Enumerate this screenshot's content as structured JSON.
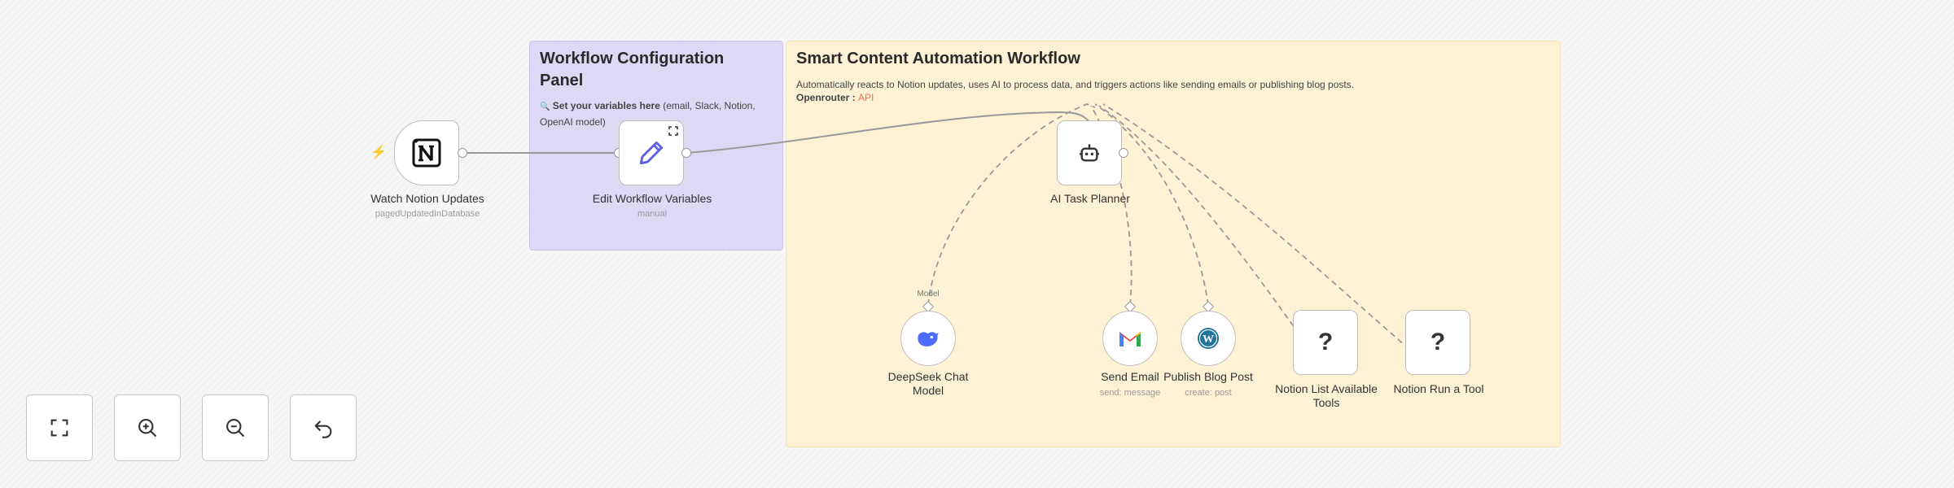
{
  "stickies": {
    "config": {
      "title": "Workflow Configuration Panel",
      "body_icon": "🔍",
      "body_bold": "Set your variables here",
      "body_rest": " (email, Slack, Notion, OpenAI model)"
    },
    "main": {
      "title": "Smart Content Automation Workflow",
      "body": "Automatically reacts to Notion updates, uses AI to process data, and triggers actions like sending emails or publishing blog posts.",
      "provider_label": "Openrouter : ",
      "provider_link": "API"
    }
  },
  "nodes": {
    "trigger": {
      "label": "Watch Notion Updates",
      "sub": "pagedUpdatedInDatabase",
      "icon": "notion-icon",
      "bolt_icon": "⚡"
    },
    "edit": {
      "label": "Edit Workflow Variables",
      "sub": "manual",
      "icon": "pencil-icon"
    },
    "agent": {
      "label": "AI Task Planner",
      "icon": "robot-icon"
    },
    "deepseek": {
      "label_line1": "DeepSeek Chat",
      "label_line2": "Model",
      "port_label": "Model",
      "icon": "deepseek-whale-icon"
    },
    "gmail": {
      "label": "Send Email",
      "sub": "send: message",
      "icon": "gmail-icon",
      "glyph": "M"
    },
    "wordpress": {
      "label": "Publish Blog Post",
      "sub": "create: post",
      "icon": "wordpress-icon",
      "glyph": "W"
    },
    "notion_list": {
      "label_line1": "Notion List Available",
      "label_line2": "Tools",
      "glyph": "?",
      "icon": "question-icon"
    },
    "notion_run": {
      "label": "Notion Run a Tool",
      "glyph": "?",
      "icon": "question-icon"
    }
  },
  "controls": {
    "fit": "fit-view-icon",
    "zoom_in": "zoom-in-icon",
    "zoom_out": "zoom-out-icon",
    "reset": "undo-icon"
  },
  "colors": {
    "accent": "#ff6d5a",
    "sticky_purple": "#dcd9f5",
    "sticky_yellow": "#fdf2d3",
    "deepseek_blue": "#4d6bfe",
    "wordpress_blue": "#21759b"
  }
}
